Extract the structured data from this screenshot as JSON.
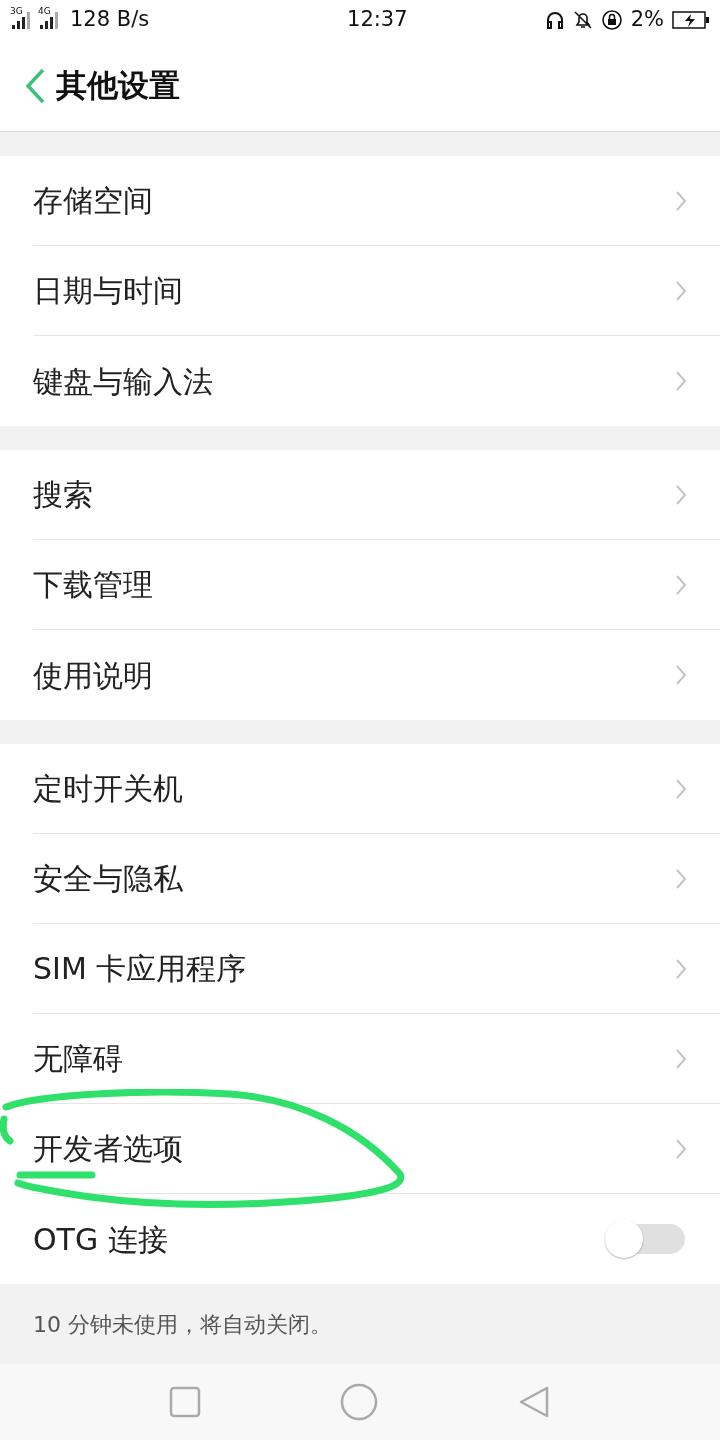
{
  "status_bar": {
    "signals": [
      "3G",
      "4G"
    ],
    "speed": "128 B/s",
    "time": "12:37",
    "battery": "2%"
  },
  "header": {
    "title": "其他设置"
  },
  "groups": [
    {
      "items": [
        {
          "kind": "link",
          "label": "存储空间"
        },
        {
          "kind": "link",
          "label": "日期与时间"
        },
        {
          "kind": "link",
          "label": "键盘与输入法"
        }
      ]
    },
    {
      "items": [
        {
          "kind": "link",
          "label": "搜索"
        },
        {
          "kind": "link",
          "label": "下载管理"
        },
        {
          "kind": "link",
          "label": "使用说明"
        }
      ]
    },
    {
      "items": [
        {
          "kind": "link",
          "label": "定时开关机"
        },
        {
          "kind": "link",
          "label": "安全与隐私"
        },
        {
          "kind": "link",
          "label": "SIM 卡应用程序"
        },
        {
          "kind": "link",
          "label": "无障碍"
        },
        {
          "kind": "link",
          "label": "开发者选项"
        },
        {
          "kind": "toggle",
          "label": "OTG 连接",
          "on": false
        }
      ]
    }
  ],
  "footer_note": "10 分钟未使用，将自动关闭。"
}
